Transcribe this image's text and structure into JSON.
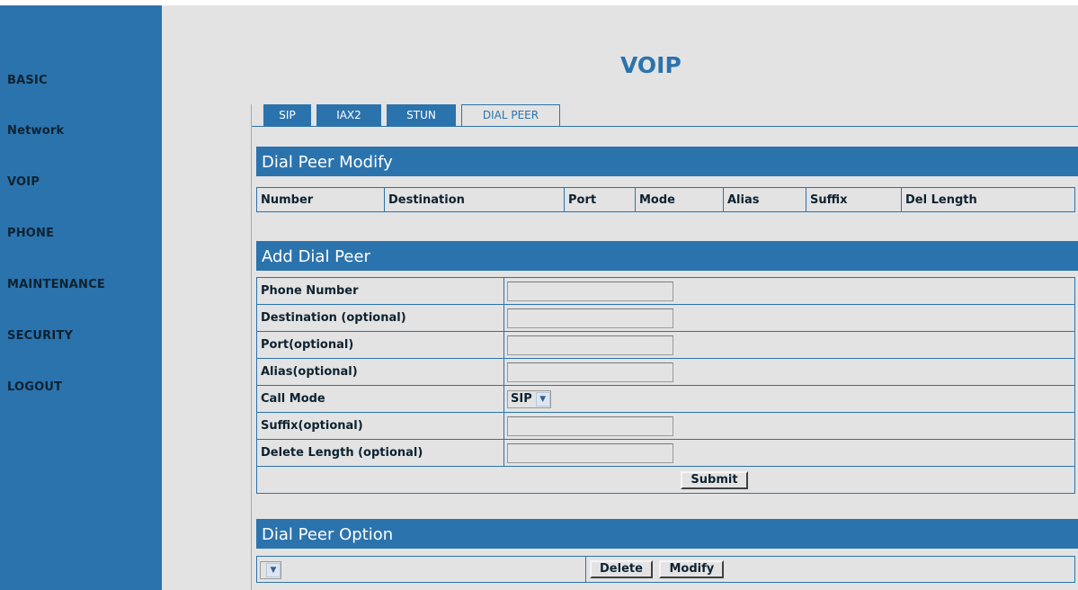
{
  "sidebar": {
    "items": [
      {
        "label": "BASIC"
      },
      {
        "label": "Network"
      },
      {
        "label": "VOIP"
      },
      {
        "label": "PHONE"
      },
      {
        "label": "MAINTENANCE"
      },
      {
        "label": "SECURITY"
      },
      {
        "label": "LOGOUT"
      }
    ]
  },
  "page_title": "VOIP",
  "tabs": [
    {
      "label": "SIP",
      "active": false
    },
    {
      "label": "IAX2",
      "active": false
    },
    {
      "label": "STUN",
      "active": false
    },
    {
      "label": "DIAL PEER",
      "active": true
    }
  ],
  "modify_section": {
    "title": "Dial Peer Modify",
    "columns": [
      "Number",
      "Destination",
      "Port",
      "Mode",
      "Alias",
      "Suffix",
      "Del Length"
    ]
  },
  "add_section": {
    "title": "Add Dial Peer",
    "fields": [
      {
        "label": "Phone Number",
        "value": ""
      },
      {
        "label": "Destination (optional)",
        "value": ""
      },
      {
        "label": "Port(optional)",
        "value": ""
      },
      {
        "label": "Alias(optional)",
        "value": ""
      },
      {
        "label": "Call Mode",
        "value": "SIP"
      },
      {
        "label": "Suffix(optional)",
        "value": ""
      },
      {
        "label": "Delete Length (optional)",
        "value": ""
      }
    ],
    "submit_label": "Submit"
  },
  "option_section": {
    "title": "Dial Peer Option",
    "selected_value": "",
    "delete_label": "Delete",
    "modify_label": "Modify"
  },
  "colors": {
    "accent": "#2b73ad",
    "background": "#e3e3e3",
    "text": "#0d2230"
  }
}
